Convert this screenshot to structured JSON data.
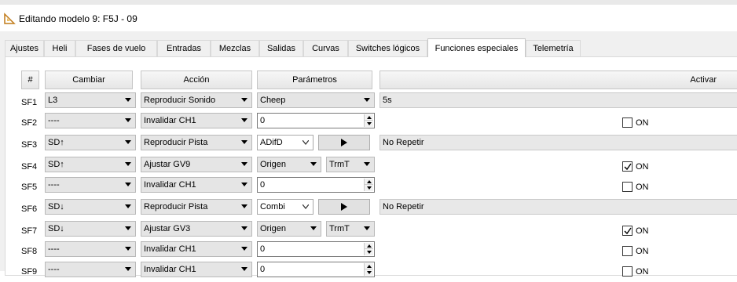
{
  "window": {
    "title": "Editando modelo 9: F5J - 09"
  },
  "tabs": [
    {
      "label": "Ajustes"
    },
    {
      "label": "Heli"
    },
    {
      "label": "Fases de vuelo"
    },
    {
      "label": "Entradas"
    },
    {
      "label": "Mezclas"
    },
    {
      "label": "Salidas"
    },
    {
      "label": "Curvas"
    },
    {
      "label": "Switches lógicos"
    },
    {
      "label": "Funciones especiales"
    },
    {
      "label": "Telemetría"
    }
  ],
  "active_tab": "Funciones especiales",
  "headers": {
    "num": "#",
    "switch": "Cambiar",
    "action": "Acción",
    "params": "Parámetros",
    "enable": "Activar"
  },
  "checkbox_label": "ON",
  "rows": [
    {
      "id": "SF1",
      "switch": "L3",
      "action": "Reproducir Sonido",
      "param_combo": "Cheep",
      "param_text": "5s"
    },
    {
      "id": "SF2",
      "switch": "----",
      "action": "Invalidar CH1",
      "param_value": "0",
      "checked": false
    },
    {
      "id": "SF3",
      "switch": "SD↑",
      "action": "Reproducir Pista",
      "track": "ADifD",
      "repeat": "No Repetir"
    },
    {
      "id": "SF4",
      "switch": "SD↑",
      "action": "Ajustar GV9",
      "source": "Origen",
      "source_value": "TrmT",
      "checked": true
    },
    {
      "id": "SF5",
      "switch": "----",
      "action": "Invalidar CH1",
      "param_value": "0",
      "checked": false
    },
    {
      "id": "SF6",
      "switch": "SD↓",
      "action": "Reproducir Pista",
      "track": "Combi",
      "repeat": "No Repetir"
    },
    {
      "id": "SF7",
      "switch": "SD↓",
      "action": "Ajustar GV3",
      "source": "Origen",
      "source_value": "TrmT",
      "checked": true
    },
    {
      "id": "SF8",
      "switch": "----",
      "action": "Invalidar CH1",
      "param_value": "0",
      "checked": false
    },
    {
      "id": "SF9",
      "switch": "----",
      "action": "Invalidar CH1",
      "param_value": "0",
      "checked": false
    }
  ]
}
